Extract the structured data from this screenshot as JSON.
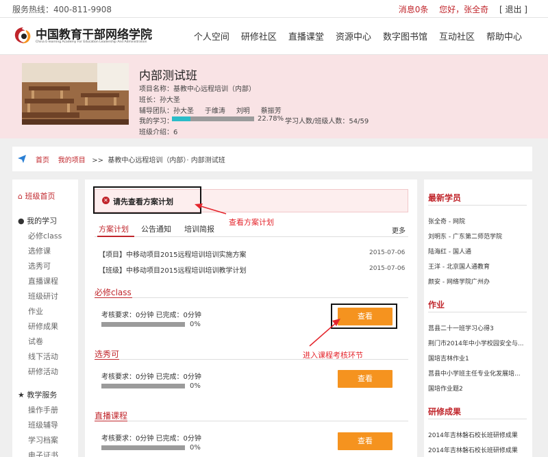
{
  "topbar": {
    "hotline": "服务热线：400-811-9908",
    "messages": "消息0条",
    "greeting": "您好，张全奇",
    "logout": "[ 退出 ]"
  },
  "header": {
    "logo_cn": "中国教育干部网络学院",
    "logo_en": "China E-learning Academy For Education Leadership And Administration",
    "nav": [
      "个人空间",
      "研修社区",
      "直播课堂",
      "资源中心",
      "数字图书馆",
      "互动社区",
      "帮助中心"
    ]
  },
  "banner": {
    "title": "内部测试班",
    "project": "项目名称：基教中心远程培训（内部）",
    "leader": "班长：孙大圣",
    "team_label": "辅导团队：",
    "team": [
      "孙大圣",
      "于维涛",
      "刘明",
      "蔡振芳"
    ],
    "study_label": "我的学习：",
    "study_percent": "22.78%",
    "study_fraction": 0.2278,
    "counts": "学习人数/班级人数：54/59",
    "intro": "班级介绍：6"
  },
  "breadcrumb": {
    "home": "首页",
    "projects": "我的项目",
    "sep": ">>",
    "current": "基教中心远程培训（内部）· 内部测试班"
  },
  "sidebar": {
    "class_home": "班级首页",
    "my_study": "我的学习",
    "study_items": [
      "必修class",
      "选修课",
      "选秀可",
      "直播课程",
      "班级研讨",
      "作业",
      "研修成果",
      "试卷",
      "线下活动",
      "研修活动"
    ],
    "teaching": "教学服务",
    "teaching_items": [
      "操作手册",
      "班级辅导",
      "学习档案",
      "电子证书"
    ]
  },
  "main": {
    "alert": "请先查看方案计划",
    "tabs": [
      "方案计划",
      "公告通知",
      "培训简报"
    ],
    "more": "更多",
    "plans": [
      {
        "title": "【项目】中移动项目2015远程培训培训实施方案",
        "date": "2015-07-06"
      },
      {
        "title": "【班级】中移动项目2015远程培训培训教学计划",
        "date": "2015-07-06"
      }
    ],
    "sections": [
      {
        "title": "必修class",
        "req": "考核要求：0分钟 已完成：0分钟",
        "pct": "0%",
        "button": "查看"
      },
      {
        "title": "选秀可",
        "req": "考核要求：0分钟 已完成：0分钟",
        "pct": "0%",
        "button": "查看"
      },
      {
        "title": "直播课程",
        "req": "考核要求：0分钟 已完成：0分钟",
        "pct": "0%",
        "button": "查看"
      }
    ],
    "annotation_plan": "查看方案计划",
    "annotation_course": "进入课程考核环节"
  },
  "right": {
    "members_title": "最新学员",
    "members": [
      "张全奇 - 网院",
      "刘明东 - 广东第二师范学院",
      "陆海红 - 国人通",
      "王洋 - 北京国人通教育",
      "颜安 - 网络学院广州办"
    ],
    "homework_title": "作业",
    "homework": [
      "莒县二十一班学习心得3",
      "荆门市2014年中小学校园安全与...",
      "国培吉林作业1",
      "莒县中小学班主任专业化发展培...",
      "国培作业题2"
    ],
    "results_title": "研修成果",
    "results": [
      "2014年吉林磐石校长班研修成果",
      "2014年吉林磐石校长班研修成果"
    ]
  },
  "colors": {
    "brand_red": "#c0252b",
    "button_orange": "#f5931f",
    "progress_teal": "#2bbcc8",
    "banner_pink": "#f9e3e5"
  }
}
